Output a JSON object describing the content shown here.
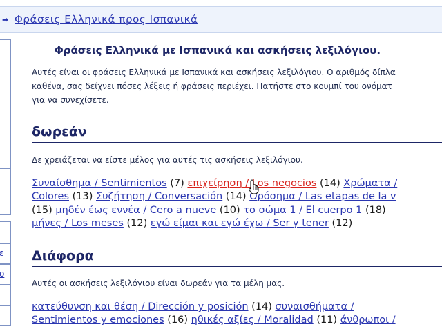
{
  "header": {
    "breadcrumb_label": "Φράσεις Ελληνικά προς Ισπανικά"
  },
  "sidebar": {
    "fragments": [
      "ε",
      "ο"
    ]
  },
  "main": {
    "title": "Φράσεις Ελληνικά με Ισπανικά και ασκήσεις λεξιλόγιου.",
    "intro_lines": [
      "Αυτές είναι οι φράσεις Ελληνικά με Ισπανικά και ασκήσεις λεξιλόγιου. Ο αριθμός δίπλα",
      "καθένα, σας δείχνει πόσες λέξεις ή φράσεις περιέχει. Πατήστε στο κουμπί του ονόματ",
      "για να συνεχίσετε."
    ]
  },
  "sections": [
    {
      "heading": "δωρεάν",
      "note": "Δε χρειάζεται να είστε μέλος για αυτές τις ασκήσεις λεξιλόγιου.",
      "rows": [
        [
          {
            "label": "Συναίσθημα / Sentimientos",
            "count": "(7)"
          },
          {
            "label": "επιχείρηση / Los negocios",
            "count": "(14)",
            "active": true
          },
          {
            "label": "Χρώματα /",
            "count": ""
          }
        ],
        [
          {
            "label": "Colores",
            "count": "(13)"
          },
          {
            "label": "Συζήτηση / Conversación",
            "count": "(14)"
          },
          {
            "label": "Ορόσημα / Las etapas de la v",
            "count": ""
          }
        ],
        [
          {
            "label": "",
            "count": "(15)"
          },
          {
            "label": "μηδέν έως εννέα / Cero a nueve",
            "count": "(10)"
          },
          {
            "label": "το σώμα 1 / El cuerpo 1",
            "count": "(18)"
          },
          {
            "label": "",
            "count": ""
          }
        ],
        [
          {
            "label": "μήνες / Los meses",
            "count": "(12)"
          },
          {
            "label": "εγώ είμαι και εγώ έχω / Ser y tener",
            "count": "(12)"
          }
        ]
      ]
    },
    {
      "heading": "Διάφορα",
      "note": "Αυτές οι ασκήσεις λεξιλόγιου είναι δωρεάν για τα μέλη μας.",
      "rows": [
        [
          {
            "label": "κατεύθυνση και θέση / Dirección y posición",
            "count": "(14)"
          },
          {
            "label": "συναισθήματα /",
            "count": ""
          }
        ],
        [
          {
            "label": "Sentimientos y emociones",
            "count": "(16)"
          },
          {
            "label": "ηθικές αξίες / Moralidad",
            "count": "(11)"
          },
          {
            "label": "άνθρωποι /",
            "count": ""
          }
        ]
      ]
    }
  ],
  "colors": {
    "link": "#2a36b1",
    "active_link": "#d8231d",
    "heading": "#1d2666",
    "header_band": "#eef3fc"
  }
}
